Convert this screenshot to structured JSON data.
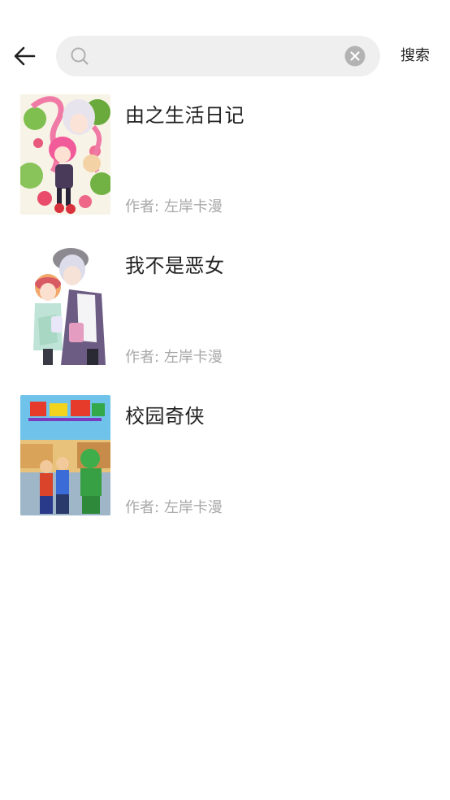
{
  "header": {
    "search_placeholder": "",
    "search_value": "",
    "search_button_label": "搜索"
  },
  "results": [
    {
      "title": "由之生活日记",
      "author_label": "作者:",
      "author": "左岸卡漫",
      "cover": "cover-pink-floral"
    },
    {
      "title": "我不是恶女",
      "author_label": "作者:",
      "author": "左岸卡漫",
      "cover": "cover-couple"
    },
    {
      "title": "校园奇侠",
      "author_label": "作者:",
      "author": "左岸卡漫",
      "cover": "cover-school-heroes"
    }
  ],
  "colors": {
    "search_bg": "#efefef",
    "title_text": "#222222",
    "author_text": "#a8a8a8",
    "icon_gray": "#b0b0b0"
  }
}
